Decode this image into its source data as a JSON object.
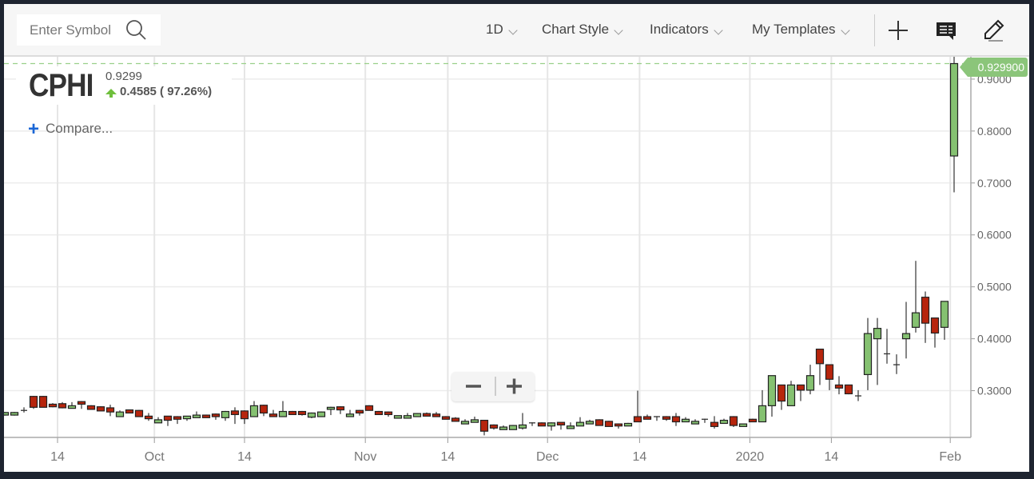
{
  "toolbar": {
    "search_placeholder": "Enter Symbol",
    "menus": [
      {
        "label": "1D"
      },
      {
        "label": "Chart Style"
      },
      {
        "label": "Indicators"
      },
      {
        "label": "My Templates"
      }
    ],
    "icons": [
      "plus-icon",
      "comment-icon",
      "pencil-icon"
    ]
  },
  "legend": {
    "symbol": "CPHI",
    "price": "0.9299",
    "change": "0.4585 ( 97.26%)",
    "direction": "up",
    "compare_label": "Compare..."
  },
  "zoom_controls": {
    "minus": "−",
    "plus": "+"
  },
  "colors": {
    "up": "#85c171",
    "down": "#b7250d",
    "last_price": "#8bc57a",
    "compare": "#1a66d6"
  },
  "chart_data": {
    "type": "candlestick",
    "interval": "1D",
    "ylim": [
      0.21,
      0.943
    ],
    "y_ticks": [
      "0.3000",
      "0.4000",
      "0.5000",
      "0.6000",
      "0.7000",
      "0.8000",
      "0.9000"
    ],
    "last_price_label": "0.929900",
    "last_price": 0.9299,
    "grid": true,
    "x_ticks": [
      {
        "label": "14",
        "candle_index": 5.5
      },
      {
        "label": "Oct",
        "candle_index": 15.6
      },
      {
        "label": "14",
        "candle_index": 25
      },
      {
        "label": "Nov",
        "candle_index": 37.6
      },
      {
        "label": "14",
        "candle_index": 46.2
      },
      {
        "label": "Dec",
        "candle_index": 56.6
      },
      {
        "label": "14",
        "candle_index": 66.2
      },
      {
        "label": "2020",
        "candle_index": 77.7
      },
      {
        "label": "14",
        "candle_index": 86.2
      },
      {
        "label": "Feb",
        "candle_index": 98.6
      }
    ],
    "ohlc": [
      [
        0.253,
        0.259,
        0.252,
        0.258
      ],
      [
        0.253,
        0.259,
        0.252,
        0.258
      ],
      [
        0.262,
        0.268,
        0.258,
        0.262
      ],
      [
        0.289,
        0.29,
        0.265,
        0.268
      ],
      [
        0.289,
        0.29,
        0.268,
        0.268
      ],
      [
        0.274,
        0.276,
        0.268,
        0.269
      ],
      [
        0.275,
        0.278,
        0.266,
        0.267
      ],
      [
        0.266,
        0.278,
        0.266,
        0.271
      ],
      [
        0.279,
        0.28,
        0.265,
        0.274
      ],
      [
        0.271,
        0.272,
        0.264,
        0.264
      ],
      [
        0.269,
        0.27,
        0.261,
        0.261
      ],
      [
        0.267,
        0.273,
        0.251,
        0.259
      ],
      [
        0.25,
        0.262,
        0.25,
        0.259
      ],
      [
        0.263,
        0.264,
        0.257,
        0.257
      ],
      [
        0.262,
        0.263,
        0.25,
        0.25
      ],
      [
        0.251,
        0.257,
        0.242,
        0.246
      ],
      [
        0.238,
        0.249,
        0.238,
        0.244
      ],
      [
        0.251,
        0.251,
        0.232,
        0.243
      ],
      [
        0.25,
        0.251,
        0.236,
        0.245
      ],
      [
        0.246,
        0.25,
        0.242,
        0.251
      ],
      [
        0.248,
        0.26,
        0.248,
        0.253
      ],
      [
        0.253,
        0.254,
        0.248,
        0.248
      ],
      [
        0.255,
        0.256,
        0.244,
        0.25
      ],
      [
        0.248,
        0.261,
        0.242,
        0.26
      ],
      [
        0.261,
        0.268,
        0.236,
        0.254
      ],
      [
        0.261,
        0.262,
        0.236,
        0.246
      ],
      [
        0.25,
        0.28,
        0.25,
        0.271
      ],
      [
        0.272,
        0.273,
        0.251,
        0.257
      ],
      [
        0.255,
        0.263,
        0.25,
        0.25
      ],
      [
        0.25,
        0.28,
        0.25,
        0.26
      ],
      [
        0.26,
        0.261,
        0.254,
        0.254
      ],
      [
        0.26,
        0.261,
        0.252,
        0.254
      ],
      [
        0.249,
        0.258,
        0.247,
        0.257
      ],
      [
        0.25,
        0.26,
        0.25,
        0.259
      ],
      [
        0.264,
        0.269,
        0.253,
        0.268
      ],
      [
        0.269,
        0.27,
        0.255,
        0.263
      ],
      [
        0.25,
        0.263,
        0.25,
        0.255
      ],
      [
        0.262,
        0.263,
        0.252,
        0.257
      ],
      [
        0.271,
        0.272,
        0.262,
        0.262
      ],
      [
        0.26,
        0.261,
        0.254,
        0.254
      ],
      [
        0.259,
        0.26,
        0.25,
        0.254
      ],
      [
        0.247,
        0.252,
        0.247,
        0.252
      ],
      [
        0.247,
        0.257,
        0.247,
        0.252
      ],
      [
        0.25,
        0.257,
        0.25,
        0.256
      ],
      [
        0.256,
        0.258,
        0.251,
        0.251
      ],
      [
        0.255,
        0.259,
        0.25,
        0.25
      ],
      [
        0.25,
        0.251,
        0.245,
        0.245
      ],
      [
        0.247,
        0.249,
        0.241,
        0.241
      ],
      [
        0.236,
        0.245,
        0.236,
        0.241
      ],
      [
        0.239,
        0.25,
        0.239,
        0.244
      ],
      [
        0.243,
        0.243,
        0.214,
        0.222
      ],
      [
        0.234,
        0.235,
        0.225,
        0.228
      ],
      [
        0.225,
        0.233,
        0.225,
        0.23
      ],
      [
        0.225,
        0.234,
        0.225,
        0.233
      ],
      [
        0.228,
        0.257,
        0.225,
        0.234
      ],
      [
        0.238,
        0.239,
        0.232,
        0.238
      ],
      [
        0.238,
        0.239,
        0.232,
        0.232
      ],
      [
        0.232,
        0.239,
        0.223,
        0.238
      ],
      [
        0.239,
        0.239,
        0.225,
        0.234
      ],
      [
        0.227,
        0.239,
        0.227,
        0.232
      ],
      [
        0.232,
        0.249,
        0.232,
        0.239
      ],
      [
        0.236,
        0.244,
        0.236,
        0.241
      ],
      [
        0.244,
        0.245,
        0.233,
        0.233
      ],
      [
        0.241,
        0.242,
        0.231,
        0.231
      ],
      [
        0.236,
        0.237,
        0.227,
        0.232
      ],
      [
        0.232,
        0.238,
        0.232,
        0.237
      ],
      [
        0.25,
        0.3,
        0.24,
        0.24
      ],
      [
        0.25,
        0.254,
        0.245,
        0.245
      ],
      [
        0.25,
        0.251,
        0.242,
        0.25
      ],
      [
        0.25,
        0.251,
        0.242,
        0.245
      ],
      [
        0.25,
        0.257,
        0.232,
        0.24
      ],
      [
        0.24,
        0.249,
        0.24,
        0.245
      ],
      [
        0.236,
        0.245,
        0.236,
        0.241
      ],
      [
        0.245,
        0.246,
        0.238,
        0.245
      ],
      [
        0.239,
        0.251,
        0.227,
        0.231
      ],
      [
        0.237,
        0.246,
        0.237,
        0.243
      ],
      [
        0.25,
        0.251,
        0.23,
        0.233
      ],
      [
        0.231,
        0.236,
        0.231,
        0.236
      ],
      [
        0.245,
        0.246,
        0.24,
        0.24
      ],
      [
        0.24,
        0.301,
        0.24,
        0.271
      ],
      [
        0.271,
        0.329,
        0.25,
        0.329
      ],
      [
        0.311,
        0.311,
        0.263,
        0.28
      ],
      [
        0.271,
        0.319,
        0.271,
        0.311
      ],
      [
        0.311,
        0.311,
        0.28,
        0.301
      ],
      [
        0.301,
        0.35,
        0.293,
        0.329
      ],
      [
        0.38,
        0.38,
        0.311,
        0.352
      ],
      [
        0.35,
        0.35,
        0.301,
        0.322
      ],
      [
        0.311,
        0.328,
        0.293,
        0.305
      ],
      [
        0.311,
        0.311,
        0.293,
        0.294
      ],
      [
        0.29,
        0.301,
        0.28,
        0.29
      ],
      [
        0.331,
        0.44,
        0.301,
        0.41
      ],
      [
        0.4,
        0.44,
        0.311,
        0.42
      ],
      [
        0.371,
        0.419,
        0.352,
        0.371
      ],
      [
        0.35,
        0.37,
        0.332,
        0.35
      ],
      [
        0.4,
        0.471,
        0.362,
        0.41
      ],
      [
        0.422,
        0.55,
        0.412,
        0.45
      ],
      [
        0.48,
        0.491,
        0.392,
        0.43
      ],
      [
        0.44,
        0.44,
        0.383,
        0.411
      ],
      [
        0.422,
        0.472,
        0.398,
        0.472
      ],
      [
        0.752,
        0.945,
        0.682,
        0.9299
      ]
    ]
  }
}
